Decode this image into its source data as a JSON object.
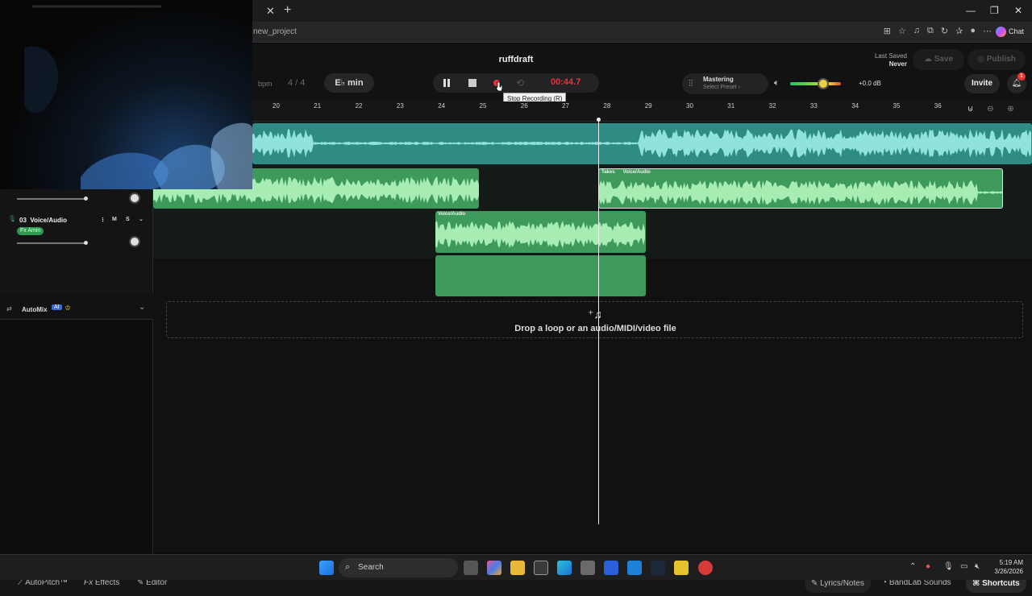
{
  "browser": {
    "url": "new_project",
    "window_controls": [
      "—",
      "❐",
      "✕"
    ],
    "chat_label": "Chat"
  },
  "header": {
    "project_title": "ruffdraft",
    "bpm_label": "bpm",
    "time_signature": "4 / 4",
    "key": "E♭ min",
    "recording_time": "00:44.7",
    "tooltip": "Stop Recording (R)",
    "mastering_label": "Mastering",
    "mastering_preset": "Select Preset ›",
    "volume_db": "+0.0 dB",
    "volume_level": 0.65,
    "last_saved_label": "Last Saved",
    "last_saved_value": "Never",
    "save_label": "Save",
    "publish_label": "Publish",
    "invite_label": "Invite",
    "notification_count": "1"
  },
  "ruler": {
    "ticks": [
      "20",
      "21",
      "22",
      "23",
      "24",
      "25",
      "26",
      "27",
      "28",
      "29",
      "30",
      "31",
      "32",
      "33",
      "34",
      "35",
      "36"
    ]
  },
  "tracks": [
    {
      "number": "03",
      "name": "Voice/Audio",
      "fx": "Fx Amin",
      "mute": "M",
      "solo": "S"
    }
  ],
  "clips": {
    "takes_label": "Takes",
    "voice_label": "Voice/Audio",
    "voice_label_2": "Voice/Audio"
  },
  "automix": {
    "label": "AutoMix",
    "badge": "AI"
  },
  "dropzone": {
    "text": "Drop a loop or an audio/MIDI/video file"
  },
  "footer": {
    "autopitch": "AutoPitch™",
    "effects": "Effects",
    "editor": "Editor",
    "lyrics": "Lyrics/Notes",
    "sounds": "BandLab Sounds",
    "shortcuts": "Shortcuts"
  },
  "taskbar": {
    "search_label": "Search",
    "time": "5:19 AM",
    "date": "3/26/2026"
  },
  "colors": {
    "teal_clip": "#2e8c84",
    "green_clip": "#3d9a5c",
    "record_red": "#e8333a"
  }
}
